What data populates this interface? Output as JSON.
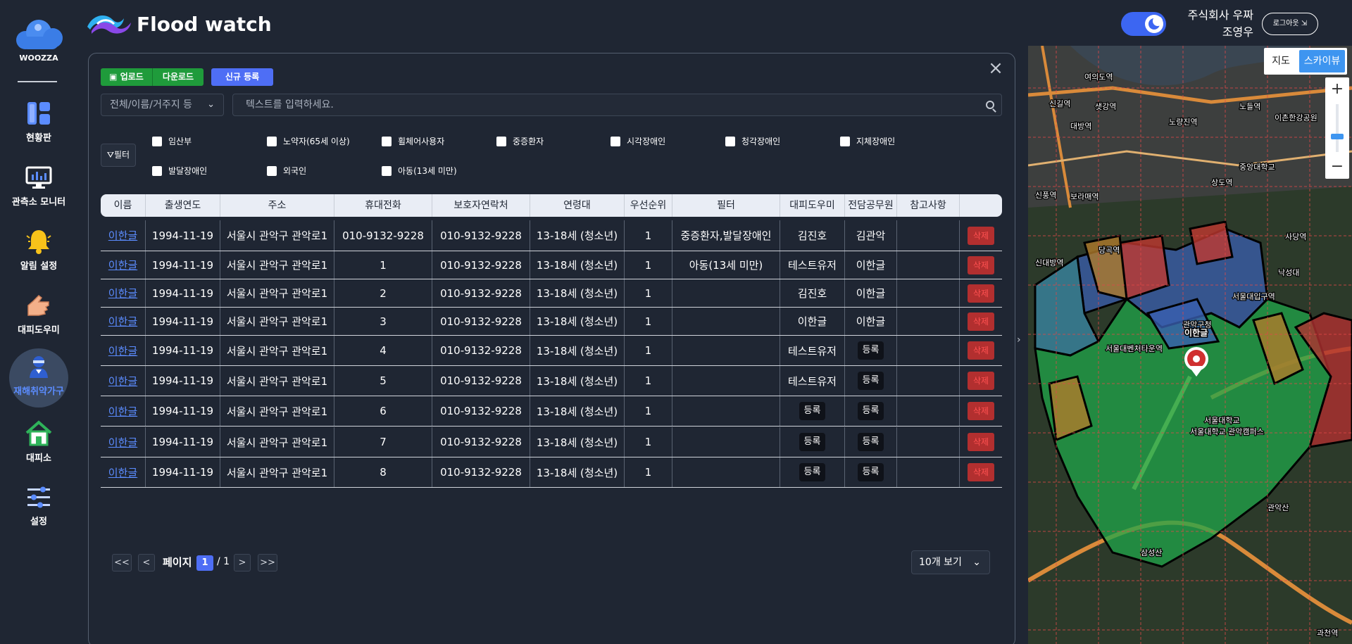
{
  "brand": {
    "name": "WOOZZA"
  },
  "app": {
    "title": "Flood watch"
  },
  "sidebar": {
    "items": [
      {
        "label": "현황판",
        "icon": "dashboard-icon"
      },
      {
        "label": "관측소 모니터",
        "icon": "monitor-icon"
      },
      {
        "label": "알림 설정",
        "icon": "bell-icon"
      },
      {
        "label": "대피도우미",
        "icon": "helper-hand-icon"
      },
      {
        "label": "재해취약가구",
        "icon": "vulnerable-household-icon",
        "active": true
      },
      {
        "label": "대피소",
        "icon": "shelter-icon"
      },
      {
        "label": "설정",
        "icon": "settings-sliders-icon"
      }
    ]
  },
  "header": {
    "company": "주식회사 우짜",
    "user": "조영우",
    "logout_label": "로그아웃"
  },
  "toolbar": {
    "upload_label": "업로드",
    "download_label": "다운로드",
    "new_label": "신규 등록"
  },
  "search": {
    "select_value": "전체/이름/거주지 등",
    "placeholder": "텍스트를 입력하세요."
  },
  "filters": {
    "button_label": "필터",
    "options": [
      "임산부",
      "노약자(65세 이상)",
      "휠체어사용자",
      "중증환자",
      "시각장애인",
      "청각장애인",
      "지체장애인",
      "발달장애인",
      "외국인",
      "아동(13세 미만)"
    ]
  },
  "table": {
    "columns": [
      "이름",
      "출생연도",
      "주소",
      "휴대전화",
      "보호자연락처",
      "연령대",
      "우선순위",
      "필터",
      "대피도우미",
      "전담공무원",
      "참고사항"
    ],
    "delete_label": "삭제",
    "register_label": "등록",
    "rows": [
      {
        "name": "이한글",
        "birth": "1994-11-19",
        "address": "서울시 관악구 관악로1",
        "phone": "010-9132-9228",
        "guardian": "010-9132-9228",
        "age": "13-18세 (청소년)",
        "priority": "1",
        "filter": "중증환자,발달장애인",
        "helper": "김진호",
        "officer": "김관악",
        "note": ""
      },
      {
        "name": "이한글",
        "birth": "1994-11-19",
        "address": "서울시 관악구 관악로1",
        "phone": "1",
        "guardian": "010-9132-9228",
        "age": "13-18세 (청소년)",
        "priority": "1",
        "filter": "아동(13세 미만)",
        "helper": "테스트유저",
        "officer": "이한글",
        "note": ""
      },
      {
        "name": "이한글",
        "birth": "1994-11-19",
        "address": "서울시 관악구 관악로1",
        "phone": "2",
        "guardian": "010-9132-9228",
        "age": "13-18세 (청소년)",
        "priority": "1",
        "filter": "",
        "helper": "김진호",
        "officer": "이한글",
        "note": ""
      },
      {
        "name": "이한글",
        "birth": "1994-11-19",
        "address": "서울시 관악구 관악로1",
        "phone": "3",
        "guardian": "010-9132-9228",
        "age": "13-18세 (청소년)",
        "priority": "1",
        "filter": "",
        "helper": "이한글",
        "officer": "이한글",
        "note": ""
      },
      {
        "name": "이한글",
        "birth": "1994-11-19",
        "address": "서울시 관악구 관악로1",
        "phone": "4",
        "guardian": "010-9132-9228",
        "age": "13-18세 (청소년)",
        "priority": "1",
        "filter": "",
        "helper": "테스트유저",
        "officer": "등록",
        "note": ""
      },
      {
        "name": "이한글",
        "birth": "1994-11-19",
        "address": "서울시 관악구 관악로1",
        "phone": "5",
        "guardian": "010-9132-9228",
        "age": "13-18세 (청소년)",
        "priority": "1",
        "filter": "",
        "helper": "테스트유저",
        "officer": "등록",
        "note": ""
      },
      {
        "name": "이한글",
        "birth": "1994-11-19",
        "address": "서울시 관악구 관악로1",
        "phone": "6",
        "guardian": "010-9132-9228",
        "age": "13-18세 (청소년)",
        "priority": "1",
        "filter": "",
        "helper": "등록",
        "officer": "등록",
        "note": ""
      },
      {
        "name": "이한글",
        "birth": "1994-11-19",
        "address": "서울시 관악구 관악로1",
        "phone": "7",
        "guardian": "010-9132-9228",
        "age": "13-18세 (청소년)",
        "priority": "1",
        "filter": "",
        "helper": "등록",
        "officer": "등록",
        "note": ""
      },
      {
        "name": "이한글",
        "birth": "1994-11-19",
        "address": "서울시 관악구 관악로1",
        "phone": "8",
        "guardian": "010-9132-9228",
        "age": "13-18세 (청소년)",
        "priority": "1",
        "filter": "",
        "helper": "등록",
        "officer": "등록",
        "note": ""
      }
    ]
  },
  "pagination": {
    "first": "<<",
    "prev": "<",
    "label": "페이지",
    "current": "1",
    "total": "/ 1",
    "next": ">",
    "last": ">>",
    "per_page": "10개 보기"
  },
  "map": {
    "type_map": "지도",
    "type_sky": "스카이뷰",
    "zoom_in": "+",
    "zoom_out": "−",
    "marker_label": "이한글",
    "place_labels": [
      "여의도역",
      "신길역",
      "샛강역",
      "노량진역",
      "대방역",
      "노들역",
      "이촌한강공원",
      "중앙대학교",
      "상도역",
      "신풍역",
      "보라매역",
      "당곡역",
      "신대방역",
      "관악구청",
      "서울대벤처타운역",
      "서울대입구역",
      "서울대학교",
      "관악산",
      "삼성산",
      "낙성대",
      "사당역",
      "서울대학교 관악캠퍼스",
      "과천역"
    ]
  }
}
